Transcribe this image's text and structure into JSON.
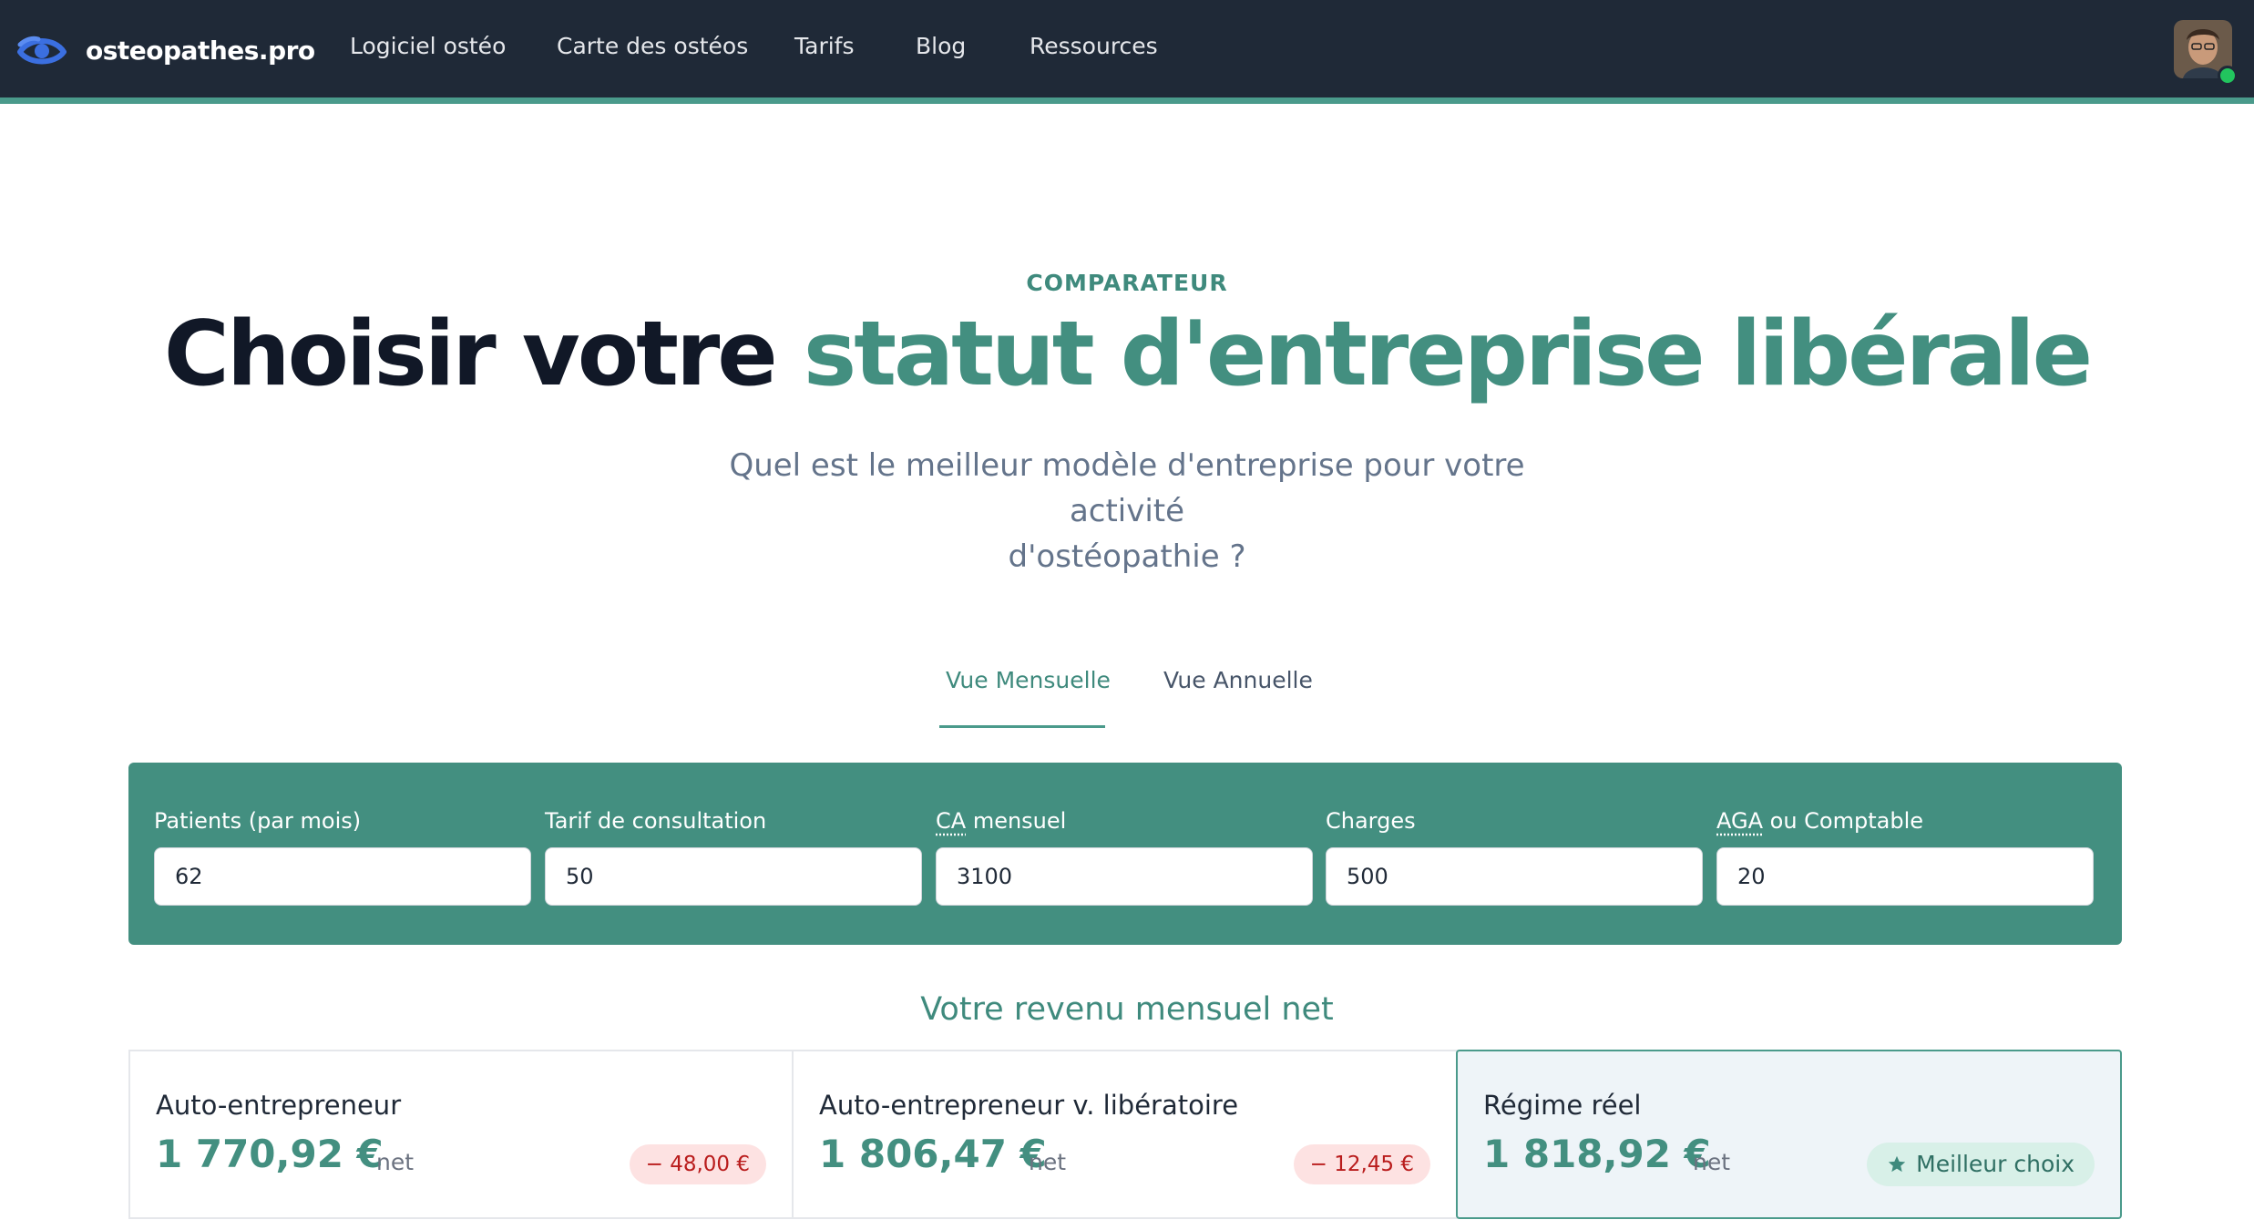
{
  "navbar": {
    "brand": "osteopathes.pro",
    "items": [
      {
        "label": "Logiciel ostéo"
      },
      {
        "label": "Carte des ostéos"
      },
      {
        "label": "Tarifs"
      },
      {
        "label": "Blog"
      },
      {
        "label": "Ressources"
      }
    ],
    "logo_icon": "eye-logo-icon",
    "avatar": "user-avatar",
    "status": "online",
    "colors": {
      "bar": "#1f2937",
      "accent_line": "#4a9a8b"
    }
  },
  "hero": {
    "eyebrow": "COMPARATEUR",
    "title_dark": "Choisir votre ",
    "title_accent": "statut d'entreprise libérale",
    "subtitle_line1": "Quel est le meilleur modèle d'entreprise pour votre activité",
    "subtitle_line2": "d'ostéopathie ?",
    "accent_color": "#438f80"
  },
  "tabs": [
    {
      "label": "Vue Mensuelle",
      "active": true
    },
    {
      "label": "Vue Annuelle",
      "active": false
    }
  ],
  "inputs": [
    {
      "label": "Patients (par mois)",
      "value": "62"
    },
    {
      "label": "Tarif de consultation",
      "value": "50"
    },
    {
      "label_abbr": "CA",
      "label_rest": " mensuel",
      "value": "3100"
    },
    {
      "label": "Charges",
      "value": "500"
    },
    {
      "label_abbr": "AGA",
      "label_rest": " ou Comptable",
      "value": "20"
    }
  ],
  "results": {
    "title": "Votre revenu mensuel net",
    "cards": [
      {
        "title": "Auto-entrepreneur",
        "amount": "1 770,92  €",
        "net": "net",
        "diff": "− 48,00 €"
      },
      {
        "title": "Auto-entrepreneur v. libératoire",
        "amount": "1 806,47 €",
        "net": "net",
        "diff": "− 12,45 €"
      },
      {
        "title": "Régime réel",
        "amount": "1 818,92 €",
        "net": "net",
        "badge": "Meilleur choix",
        "badge_icon": "star-icon",
        "best": true
      }
    ]
  }
}
